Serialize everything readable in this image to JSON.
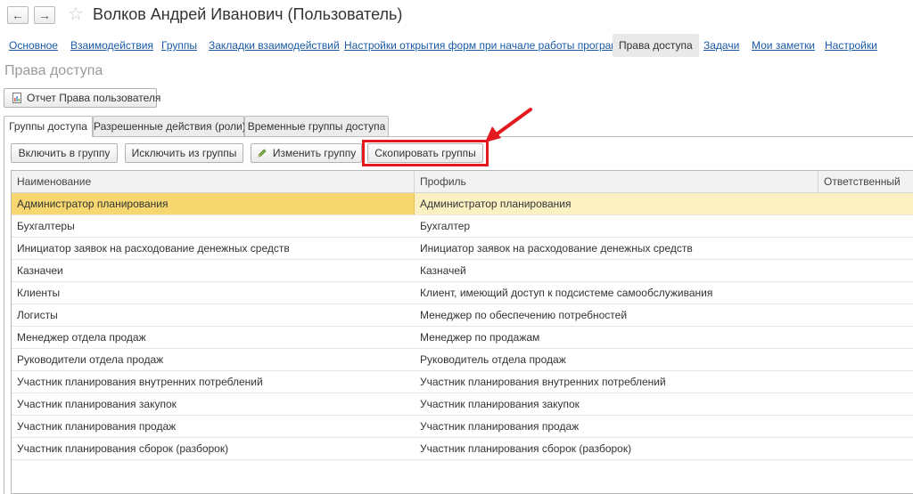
{
  "window": {
    "title": "Волков Андрей Иванович (Пользователь)",
    "back_icon": "←",
    "forward_icon": "→",
    "favorite_icon": "☆"
  },
  "nav_tabs": [
    {
      "label": "Основное"
    },
    {
      "label": "Взаимодействия"
    },
    {
      "label": "Группы"
    },
    {
      "label": "Закладки взаимодействий"
    },
    {
      "label": "Настройки открытия форм при начале работы программы"
    },
    {
      "label": "Права доступа"
    },
    {
      "label": "Задачи"
    },
    {
      "label": "Мои заметки"
    },
    {
      "label": "Настройки"
    }
  ],
  "page_title": "Права доступа",
  "report_button": "Отчет Права пользователя",
  "form_tabs": [
    {
      "label": "Группы доступа"
    },
    {
      "label": "Разрешенные действия (роли)"
    },
    {
      "label": "Временные группы доступа"
    }
  ],
  "toolbar": {
    "include": "Включить в группу",
    "exclude": "Исключить из группы",
    "edit": "Изменить группу",
    "copy": "Скопировать группы"
  },
  "table": {
    "columns": [
      "Наименование",
      "Профиль",
      "Ответственный"
    ],
    "rows": [
      {
        "name": "Администратор планирования",
        "profile": "Администратор планирования",
        "resp": ""
      },
      {
        "name": "Бухгалтеры",
        "profile": "Бухгалтер",
        "resp": ""
      },
      {
        "name": "Инициатор заявок на расходование денежных средств",
        "profile": "Инициатор заявок на расходование денежных средств",
        "resp": ""
      },
      {
        "name": "Казначеи",
        "profile": "Казначей",
        "resp": ""
      },
      {
        "name": "Клиенты",
        "profile": "Клиент, имеющий доступ к подсистеме самообслуживания",
        "resp": ""
      },
      {
        "name": "Логисты",
        "profile": "Менеджер по обеспечению потребностей",
        "resp": ""
      },
      {
        "name": "Менеджер отдела продаж",
        "profile": "Менеджер по продажам",
        "resp": ""
      },
      {
        "name": "Руководители отдела продаж",
        "profile": "Руководитель отдела продаж",
        "resp": ""
      },
      {
        "name": "Участник планирования внутренних потреблений",
        "profile": "Участник планирования внутренних потреблений",
        "resp": ""
      },
      {
        "name": "Участник планирования закупок",
        "profile": "Участник планирования закупок",
        "resp": ""
      },
      {
        "name": "Участник планирования продаж",
        "profile": "Участник планирования продаж",
        "resp": ""
      },
      {
        "name": "Участник планирования сборок (разборок)",
        "profile": "Участник планирования сборок (разборок)",
        "resp": ""
      }
    ]
  },
  "colors": {
    "highlight": "#e3191e",
    "selected_row": "#fbf0c2",
    "selected_cell": "#f7d770",
    "link": "#1a5aa6"
  }
}
